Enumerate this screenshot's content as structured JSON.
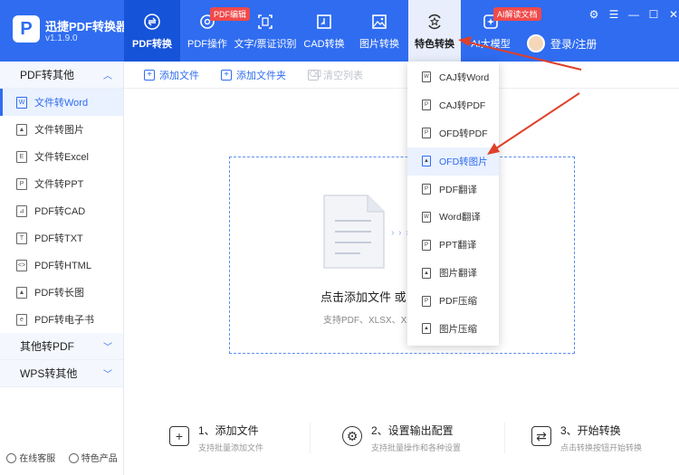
{
  "app": {
    "logo_glyph": "P",
    "name": "迅捷PDF转换器",
    "version": "v1.1.9.0"
  },
  "nav": {
    "tabs": [
      {
        "label": "PDF转换",
        "badge": ""
      },
      {
        "label": "PDF操作",
        "badge": "PDF编辑"
      },
      {
        "label": "文字/票证识别",
        "badge": ""
      },
      {
        "label": "CAD转换",
        "badge": ""
      },
      {
        "label": "图片转换",
        "badge": ""
      },
      {
        "label": "特色转换",
        "badge": ""
      },
      {
        "label": "AI大模型",
        "badge": "AI解读文档"
      }
    ],
    "user_label": "登录/注册"
  },
  "window_controls": {
    "settings": "⚙",
    "menu": "☰",
    "minimize": "—",
    "maximize": "☐",
    "close": "✕"
  },
  "sidebar": {
    "section1": {
      "label": "PDF转其他",
      "chev": "︿"
    },
    "items": [
      "文件转Word",
      "文件转图片",
      "文件转Excel",
      "文件转PPT",
      "PDF转CAD",
      "PDF转TXT",
      "PDF转HTML",
      "PDF转长图",
      "PDF转电子书"
    ],
    "section2": {
      "label": "其他转PDF",
      "chev": "﹀"
    },
    "section3": {
      "label": "WPS转其他",
      "chev": "﹀"
    },
    "footer": {
      "service": "在线客服",
      "products": "特色产品"
    }
  },
  "toolbar": {
    "add_file": "添加文件",
    "add_folder": "添加文件夹",
    "clear": "清空列表"
  },
  "dropzone": {
    "arrows": "› › ›",
    "title": "点击添加文件 或 拖",
    "subtitle": "支持PDF、XLSX、XLS"
  },
  "steps": [
    {
      "title": "1、添加文件",
      "sub": "支持批量添加文件",
      "icon": "+"
    },
    {
      "title": "2、设置输出配置",
      "sub": "支持批量操作和各种设置",
      "icon": "⚙"
    },
    {
      "title": "3、开始转换",
      "sub": "点击转换按钮开始转换",
      "icon": "⇄"
    }
  ],
  "dropdown": {
    "items": [
      {
        "label": "CAJ转Word",
        "glyph": "W"
      },
      {
        "label": "CAJ转PDF",
        "glyph": "P"
      },
      {
        "label": "OFD转PDF",
        "glyph": "P"
      },
      {
        "label": "OFD转图片",
        "glyph": "▲"
      },
      {
        "label": "PDF翻译",
        "glyph": "P"
      },
      {
        "label": "Word翻译",
        "glyph": "W"
      },
      {
        "label": "PPT翻译",
        "glyph": "P"
      },
      {
        "label": "图片翻译",
        "glyph": "▲"
      },
      {
        "label": "PDF压缩",
        "glyph": "P"
      },
      {
        "label": "图片压缩",
        "glyph": "▲"
      }
    ]
  },
  "colors": {
    "primary": "#2f6cf0",
    "annotation": "#e0402a",
    "badge": "#f04a4a"
  }
}
